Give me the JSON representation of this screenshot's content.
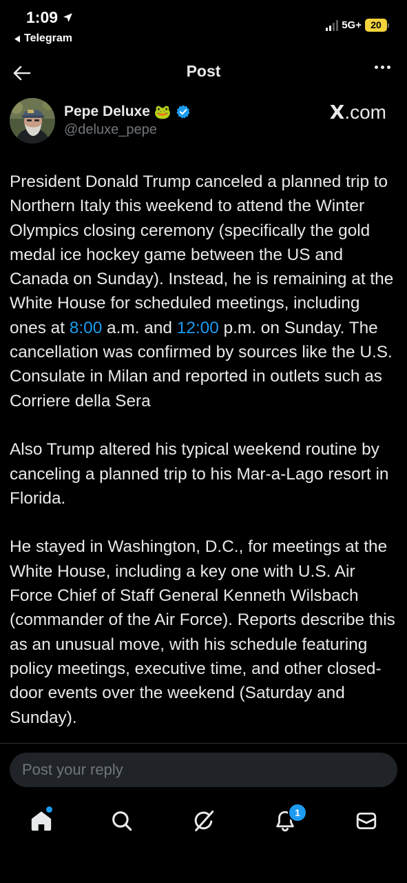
{
  "status_bar": {
    "time": "1:09",
    "back_app": "Telegram",
    "network": "5G+",
    "battery": "20"
  },
  "nav": {
    "title": "Post"
  },
  "author": {
    "display_name": "Pepe Deluxe",
    "emoji": "🐸",
    "handle": "@deluxe_pepe",
    "source_prefix": "X",
    "source_suffix": ".com"
  },
  "post": {
    "para1_a": "President Donald Trump canceled a planned trip to Northern Italy this weekend to attend the Winter Olympics closing ceremony (specifically the gold medal ice hockey game between the US and Canada on Sunday). Instead, he is remaining at the White House for scheduled meetings, including ones at ",
    "time1": "8:00",
    "para1_b": " a.m. and ",
    "time2": "12:00",
    "para1_c": " p.m. on Sunday. The cancellation was confirmed by sources like the U.S. Consulate in Milan and reported in outlets such as Corriere della Sera",
    "para2": "Also Trump altered his typical weekend routine by canceling a planned trip to his Mar-a-Lago resort in Florida.",
    "para3": "He stayed in Washington, D.C., for meetings at the White House, including a key one with U.S. Air Force Chief of Staff General Kenneth Wilsbach (commander of the Air Force). Reports describe this as an unusual move, with his schedule featuring policy meetings, executive time, and other closed-door events over the weekend (Saturday and Sunday)."
  },
  "reply": {
    "placeholder": "Post your reply"
  },
  "tab_bar": {
    "notifications_count": "1"
  },
  "colors": {
    "background": "#000000",
    "text": "#e7e9ea",
    "secondary_text": "#71767b",
    "accent": "#1d9bf0",
    "battery": "#f2d33b"
  }
}
